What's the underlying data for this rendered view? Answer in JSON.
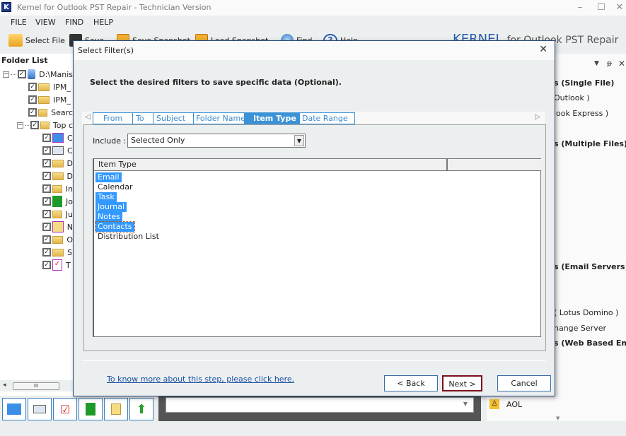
{
  "window": {
    "title": "Kernel for Outlook PST Repair - Technician Version",
    "app_icon": "K",
    "controls": [
      "minimize-icon",
      "maximize-icon",
      "close-icon"
    ]
  },
  "menu": [
    "FILE",
    "VIEW",
    "FIND",
    "HELP"
  ],
  "toolbar": {
    "items": [
      {
        "label": "Select File",
        "icon": "folder-open-icon"
      },
      {
        "label": "Save",
        "icon": "floppy-icon"
      },
      {
        "label": "Save Snapshot",
        "icon": "snapshot-icon"
      },
      {
        "label": "Load Snapshot",
        "icon": "snapshot-icon"
      },
      {
        "label": "Find",
        "icon": "find-icon"
      },
      {
        "label": "Help",
        "icon": "help-icon"
      }
    ],
    "brand": "KERNEL",
    "brand_sub": "for Outlook PST Repair"
  },
  "folder_list": {
    "title": "Folder List",
    "items": [
      {
        "label": "D:\\Manis",
        "level": 0,
        "checked": true,
        "icon": "pst-file-icon",
        "expander": "−"
      },
      {
        "label": "IPM_",
        "level": 1,
        "checked": true,
        "icon": "folder-icon"
      },
      {
        "label": "IPM_",
        "level": 1,
        "checked": true,
        "icon": "folder-icon"
      },
      {
        "label": "Searc",
        "level": 1,
        "checked": true,
        "icon": "folder-icon"
      },
      {
        "label": "Top c",
        "level": 1,
        "checked": true,
        "icon": "folder-icon",
        "expander": "−"
      },
      {
        "label": "C",
        "level": 2,
        "checked": true,
        "icon": "calendar-icon"
      },
      {
        "label": "C",
        "level": 2,
        "checked": true,
        "icon": "contacts-icon"
      },
      {
        "label": "D",
        "level": 2,
        "checked": true,
        "icon": "folder-icon"
      },
      {
        "label": "D",
        "level": 2,
        "checked": true,
        "icon": "folder-icon"
      },
      {
        "label": "In",
        "level": 2,
        "checked": true,
        "icon": "folder-icon"
      },
      {
        "label": "Jo",
        "level": 2,
        "checked": true,
        "icon": "journal-icon"
      },
      {
        "label": "Ju",
        "level": 2,
        "checked": true,
        "icon": "folder-icon"
      },
      {
        "label": "N",
        "level": 2,
        "checked": true,
        "icon": "notes-icon"
      },
      {
        "label": "O",
        "level": 2,
        "checked": true,
        "icon": "folder-icon"
      },
      {
        "label": "S",
        "level": 2,
        "checked": true,
        "icon": "folder-icon"
      },
      {
        "label": "T",
        "level": 2,
        "checked": true,
        "icon": "tasks-icon"
      }
    ],
    "scroll_thumb": "III"
  },
  "bottom_nav": [
    "calendar-icon",
    "contacts-icon",
    "tasks-icon",
    "journal-icon",
    "notes-icon",
    "up-arrow-icon"
  ],
  "right_pane": {
    "controls": [
      "dropdown-icon",
      "pin-icon",
      "close-icon"
    ],
    "lines": [
      {
        "text": "s (Single File)",
        "bold": true
      },
      {
        "text": "Outlook )",
        "bold": false
      },
      {
        "text": "look Express )",
        "bold": false
      },
      {
        "text": "s (Multiple Files)",
        "bold": true
      },
      {
        "text": "s (Email Servers)",
        "bold": true
      },
      {
        "text": "( Lotus Domino )",
        "bold": false
      },
      {
        "text": "hange Server",
        "bold": false
      },
      {
        "text": "s (Web Based Emai",
        "bold": true
      }
    ],
    "aol_label": "AOL"
  },
  "dialog": {
    "title": "Select Filter(s)",
    "instruction": "Select the desired filters to save specific data (Optional).",
    "tabs": [
      {
        "label": "From",
        "active": false
      },
      {
        "label": "To",
        "active": false
      },
      {
        "label": "Subject",
        "active": false
      },
      {
        "label": "Folder Name",
        "active": false
      },
      {
        "label": "Item Type",
        "active": true
      },
      {
        "label": "Date Range",
        "active": false
      }
    ],
    "include_label": "Include :",
    "include_value": "Selected Only",
    "list_header": "Item Type",
    "items": [
      {
        "label": "Email",
        "selected": true
      },
      {
        "label": "Calendar",
        "selected": false
      },
      {
        "label": "Task",
        "selected": true
      },
      {
        "label": "Journal",
        "selected": true
      },
      {
        "label": "Notes",
        "selected": true
      },
      {
        "label": "Contacts",
        "selected": true,
        "focused": true
      },
      {
        "label": "Distribution List",
        "selected": false
      }
    ],
    "help_link": "To know more about this step, please click here.",
    "buttons": {
      "back": "< Back",
      "next": "Next >",
      "cancel": "Cancel"
    }
  }
}
